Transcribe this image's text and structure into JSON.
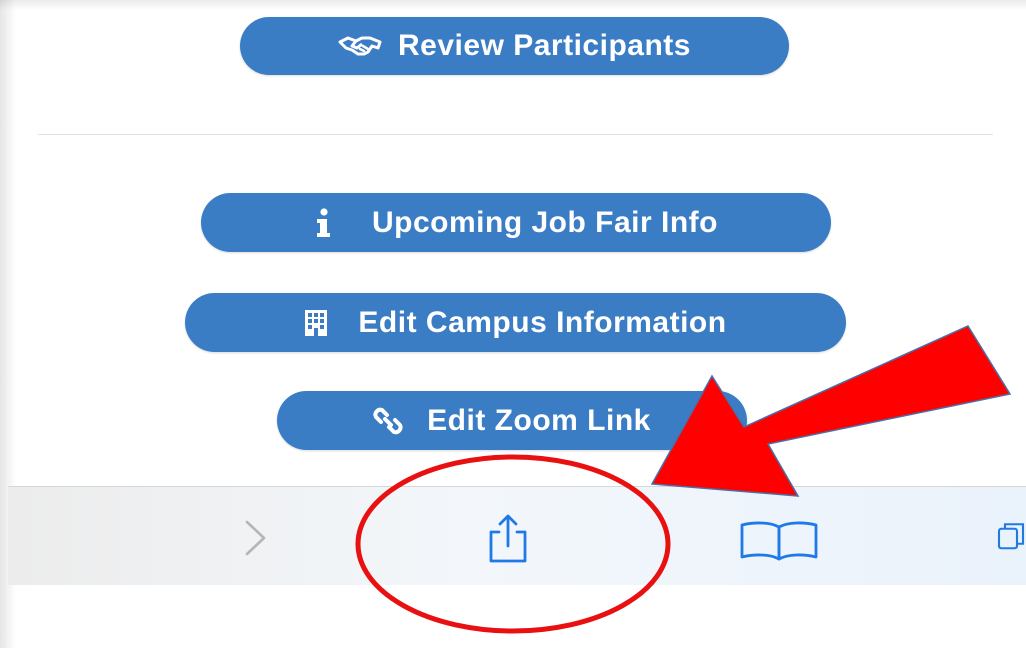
{
  "buttons": {
    "review_participants": {
      "label": "Review Participants",
      "icon": "handshake-icon"
    },
    "upcoming_job_fair_info": {
      "label": "Upcoming Job Fair Info",
      "icon": "info-icon"
    },
    "edit_campus_information": {
      "label": "Edit Campus Information",
      "icon": "building-icon"
    },
    "edit_zoom_link": {
      "label": "Edit Zoom Link",
      "icon": "link-icon"
    }
  },
  "toolbar": {
    "items": [
      "forward-chevron-icon",
      "share-icon",
      "bookmarks-book-icon",
      "tabs-icon"
    ]
  },
  "annotation": {
    "arrow_color": "#ff0000",
    "circle_color": "#e81010",
    "target": "share-icon"
  },
  "colors": {
    "button_blue": "#3b7dc4",
    "toolbar_icon_blue": "#1f7ae8",
    "chevron_gray": "#b5b5b5"
  }
}
